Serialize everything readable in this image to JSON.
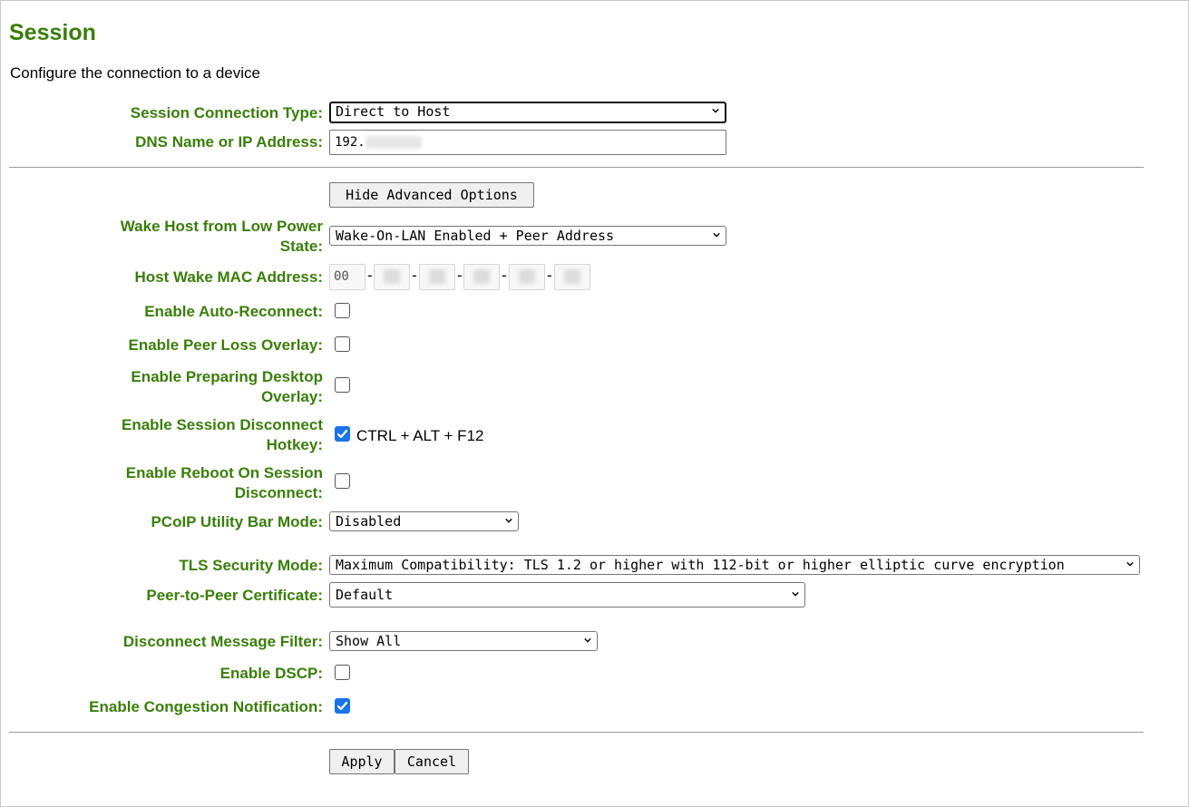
{
  "page": {
    "title": "Session",
    "subtitle": "Configure the connection to a device"
  },
  "connection": {
    "type_label": "Session Connection Type:",
    "type_value": "Direct to Host",
    "dns_label": "DNS Name or IP Address:",
    "dns_value": "192."
  },
  "advanced": {
    "toggle_label": "Hide Advanced Options",
    "wake_label_1": "Wake Host from Low Power",
    "wake_label_2": "State:",
    "wake_value": "Wake-On-LAN Enabled + Peer Address",
    "mac_label": "Host Wake MAC Address:",
    "mac_first_octet": "00",
    "mac_separator": "-",
    "auto_reconnect_label": "Enable Auto-Reconnect:",
    "auto_reconnect_checked": false,
    "peer_loss_label": "Enable Peer Loss Overlay:",
    "peer_loss_checked": false,
    "preparing_label_1": "Enable Preparing Desktop",
    "preparing_label_2": "Overlay:",
    "preparing_checked": false,
    "disconnect_hotkey_label_1": "Enable Session Disconnect",
    "disconnect_hotkey_label_2": "Hotkey:",
    "disconnect_hotkey_checked": true,
    "disconnect_hotkey_text": "CTRL + ALT + F12",
    "reboot_label_1": "Enable Reboot On Session",
    "reboot_label_2": "Disconnect:",
    "reboot_checked": false,
    "utility_bar_label": "PCoIP Utility Bar Mode:",
    "utility_bar_value": "Disabled",
    "tls_label": "TLS Security Mode:",
    "tls_value": "Maximum Compatibility: TLS 1.2 or higher with 112-bit or higher elliptic curve encryption",
    "p2p_cert_label": "Peer-to-Peer Certificate:",
    "p2p_cert_value": "Default",
    "disconnect_filter_label": "Disconnect Message Filter:",
    "disconnect_filter_value": "Show All",
    "dscp_label": "Enable DSCP:",
    "dscp_checked": false,
    "congestion_label": "Enable Congestion Notification:",
    "congestion_checked": true
  },
  "actions": {
    "apply_label": "Apply",
    "cancel_label": "Cancel"
  },
  "colors": {
    "label_green": "#3a7d0a",
    "checkbox_blue": "#1a73e8"
  },
  "icons": {
    "select_arrow": "chevron-down-icon",
    "checkmark": "checkmark-icon"
  }
}
